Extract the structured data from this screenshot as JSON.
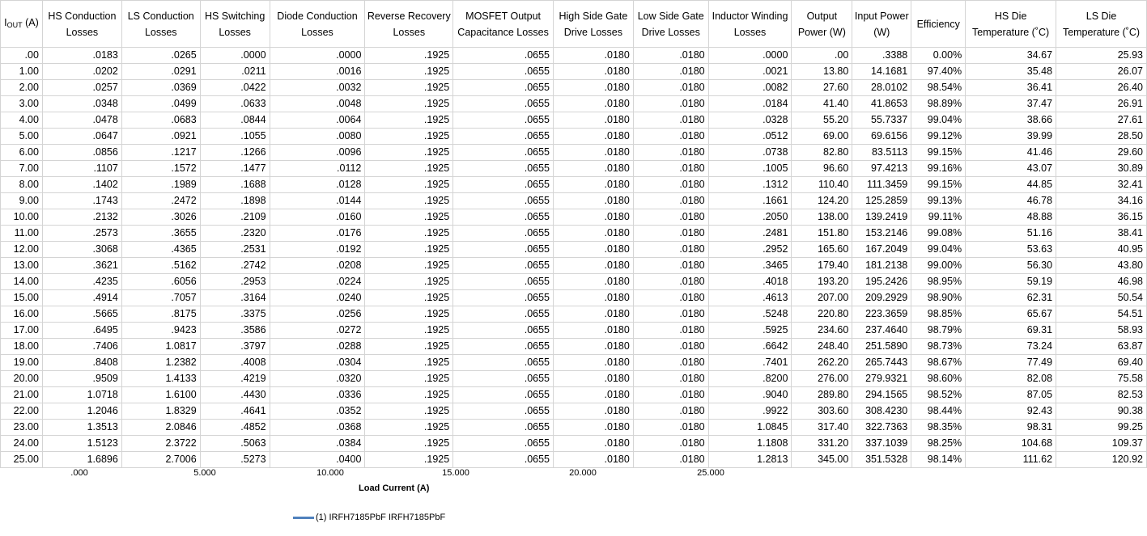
{
  "headers": [
    {
      "main": "I",
      "sub": "OUT",
      "tail": " (A)"
    },
    {
      "text": "HS Conduction Losses"
    },
    {
      "text": "LS Conduction Losses"
    },
    {
      "text": "HS Switching Losses"
    },
    {
      "text": "Diode Conduction Losses"
    },
    {
      "text": "Reverse Recovery Losses"
    },
    {
      "text": "MOSFET Output Capacitance Losses"
    },
    {
      "text": "High Side Gate Drive Losses"
    },
    {
      "text": "Low Side Gate Drive Losses"
    },
    {
      "text": "Inductor Winding Losses"
    },
    {
      "text": "Output Power (W)"
    },
    {
      "text": "Input Power (W)"
    },
    {
      "text": "Efficiency"
    },
    {
      "text": "HS Die Temperature (˚C)"
    },
    {
      "text": "LS Die Temperature (˚C)"
    }
  ],
  "rows": [
    [
      ".00",
      ".0183",
      ".0265",
      ".0000",
      ".0000",
      ".1925",
      ".0655",
      ".0180",
      ".0180",
      ".0000",
      ".00",
      ".3388",
      "0.00%",
      "34.67",
      "25.93"
    ],
    [
      "1.00",
      ".0202",
      ".0291",
      ".0211",
      ".0016",
      ".1925",
      ".0655",
      ".0180",
      ".0180",
      ".0021",
      "13.80",
      "14.1681",
      "97.40%",
      "35.48",
      "26.07"
    ],
    [
      "2.00",
      ".0257",
      ".0369",
      ".0422",
      ".0032",
      ".1925",
      ".0655",
      ".0180",
      ".0180",
      ".0082",
      "27.60",
      "28.0102",
      "98.54%",
      "36.41",
      "26.40"
    ],
    [
      "3.00",
      ".0348",
      ".0499",
      ".0633",
      ".0048",
      ".1925",
      ".0655",
      ".0180",
      ".0180",
      ".0184",
      "41.40",
      "41.8653",
      "98.89%",
      "37.47",
      "26.91"
    ],
    [
      "4.00",
      ".0478",
      ".0683",
      ".0844",
      ".0064",
      ".1925",
      ".0655",
      ".0180",
      ".0180",
      ".0328",
      "55.20",
      "55.7337",
      "99.04%",
      "38.66",
      "27.61"
    ],
    [
      "5.00",
      ".0647",
      ".0921",
      ".1055",
      ".0080",
      ".1925",
      ".0655",
      ".0180",
      ".0180",
      ".0512",
      "69.00",
      "69.6156",
      "99.12%",
      "39.99",
      "28.50"
    ],
    [
      "6.00",
      ".0856",
      ".1217",
      ".1266",
      ".0096",
      ".1925",
      ".0655",
      ".0180",
      ".0180",
      ".0738",
      "82.80",
      "83.5113",
      "99.15%",
      "41.46",
      "29.60"
    ],
    [
      "7.00",
      ".1107",
      ".1572",
      ".1477",
      ".0112",
      ".1925",
      ".0655",
      ".0180",
      ".0180",
      ".1005",
      "96.60",
      "97.4213",
      "99.16%",
      "43.07",
      "30.89"
    ],
    [
      "8.00",
      ".1402",
      ".1989",
      ".1688",
      ".0128",
      ".1925",
      ".0655",
      ".0180",
      ".0180",
      ".1312",
      "110.40",
      "111.3459",
      "99.15%",
      "44.85",
      "32.41"
    ],
    [
      "9.00",
      ".1743",
      ".2472",
      ".1898",
      ".0144",
      ".1925",
      ".0655",
      ".0180",
      ".0180",
      ".1661",
      "124.20",
      "125.2859",
      "99.13%",
      "46.78",
      "34.16"
    ],
    [
      "10.00",
      ".2132",
      ".3026",
      ".2109",
      ".0160",
      ".1925",
      ".0655",
      ".0180",
      ".0180",
      ".2050",
      "138.00",
      "139.2419",
      "99.11%",
      "48.88",
      "36.15"
    ],
    [
      "11.00",
      ".2573",
      ".3655",
      ".2320",
      ".0176",
      ".1925",
      ".0655",
      ".0180",
      ".0180",
      ".2481",
      "151.80",
      "153.2146",
      "99.08%",
      "51.16",
      "38.41"
    ],
    [
      "12.00",
      ".3068",
      ".4365",
      ".2531",
      ".0192",
      ".1925",
      ".0655",
      ".0180",
      ".0180",
      ".2952",
      "165.60",
      "167.2049",
      "99.04%",
      "53.63",
      "40.95"
    ],
    [
      "13.00",
      ".3621",
      ".5162",
      ".2742",
      ".0208",
      ".1925",
      ".0655",
      ".0180",
      ".0180",
      ".3465",
      "179.40",
      "181.2138",
      "99.00%",
      "56.30",
      "43.80"
    ],
    [
      "14.00",
      ".4235",
      ".6056",
      ".2953",
      ".0224",
      ".1925",
      ".0655",
      ".0180",
      ".0180",
      ".4018",
      "193.20",
      "195.2426",
      "98.95%",
      "59.19",
      "46.98"
    ],
    [
      "15.00",
      ".4914",
      ".7057",
      ".3164",
      ".0240",
      ".1925",
      ".0655",
      ".0180",
      ".0180",
      ".4613",
      "207.00",
      "209.2929",
      "98.90%",
      "62.31",
      "50.54"
    ],
    [
      "16.00",
      ".5665",
      ".8175",
      ".3375",
      ".0256",
      ".1925",
      ".0655",
      ".0180",
      ".0180",
      ".5248",
      "220.80",
      "223.3659",
      "98.85%",
      "65.67",
      "54.51"
    ],
    [
      "17.00",
      ".6495",
      ".9423",
      ".3586",
      ".0272",
      ".1925",
      ".0655",
      ".0180",
      ".0180",
      ".5925",
      "234.60",
      "237.4640",
      "98.79%",
      "69.31",
      "58.93"
    ],
    [
      "18.00",
      ".7406",
      "1.0817",
      ".3797",
      ".0288",
      ".1925",
      ".0655",
      ".0180",
      ".0180",
      ".6642",
      "248.40",
      "251.5890",
      "98.73%",
      "73.24",
      "63.87"
    ],
    [
      "19.00",
      ".8408",
      "1.2382",
      ".4008",
      ".0304",
      ".1925",
      ".0655",
      ".0180",
      ".0180",
      ".7401",
      "262.20",
      "265.7443",
      "98.67%",
      "77.49",
      "69.40"
    ],
    [
      "20.00",
      ".9509",
      "1.4133",
      ".4219",
      ".0320",
      ".1925",
      ".0655",
      ".0180",
      ".0180",
      ".8200",
      "276.00",
      "279.9321",
      "98.60%",
      "82.08",
      "75.58"
    ],
    [
      "21.00",
      "1.0718",
      "1.6100",
      ".4430",
      ".0336",
      ".1925",
      ".0655",
      ".0180",
      ".0180",
      ".9040",
      "289.80",
      "294.1565",
      "98.52%",
      "87.05",
      "82.53"
    ],
    [
      "22.00",
      "1.2046",
      "1.8329",
      ".4641",
      ".0352",
      ".1925",
      ".0655",
      ".0180",
      ".0180",
      ".9922",
      "303.60",
      "308.4230",
      "98.44%",
      "92.43",
      "90.38"
    ],
    [
      "23.00",
      "1.3513",
      "2.0846",
      ".4852",
      ".0368",
      ".1925",
      ".0655",
      ".0180",
      ".0180",
      "1.0845",
      "317.40",
      "322.7363",
      "98.35%",
      "98.31",
      "99.25"
    ],
    [
      "24.00",
      "1.5123",
      "2.3722",
      ".5063",
      ".0384",
      ".1925",
      ".0655",
      ".0180",
      ".0180",
      "1.1808",
      "331.20",
      "337.1039",
      "98.25%",
      "104.68",
      "109.37"
    ],
    [
      "25.00",
      "1.6896",
      "2.7006",
      ".5273",
      ".0400",
      ".1925",
      ".0655",
      ".0180",
      ".0180",
      "1.2813",
      "345.00",
      "351.5328",
      "98.14%",
      "111.62",
      "120.92"
    ]
  ],
  "axis": {
    "ticks": [
      ".000",
      "5.000",
      "10.000",
      "15.000",
      "20.000",
      "25.000"
    ],
    "title": "Load Current (A)"
  },
  "legend": {
    "label": "(1) IRFH7185PbF IRFH7185PbF",
    "color": "#4f81bd"
  }
}
